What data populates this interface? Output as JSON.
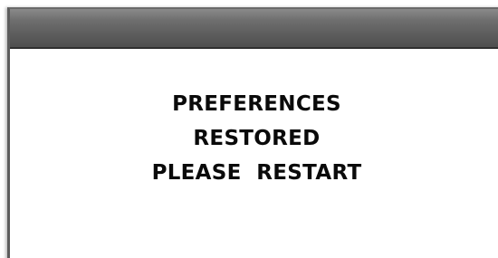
{
  "dialog": {
    "lines": [
      "PREFERENCES",
      "RESTORED",
      "PLEASE  RESTART"
    ]
  }
}
